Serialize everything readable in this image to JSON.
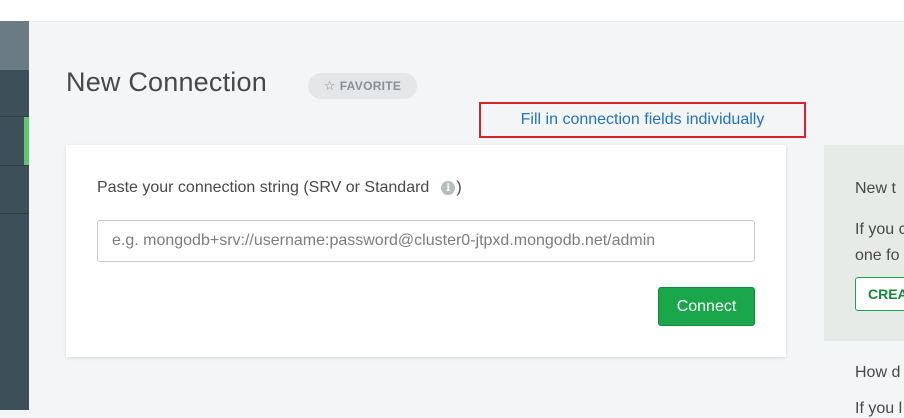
{
  "page": {
    "title": "New Connection",
    "favorite_label": "FAVORITE",
    "fill_fields_link": "Fill in connection fields individually"
  },
  "connection_card": {
    "label": "Paste your connection string (SRV or Standard",
    "label_suffix": ")",
    "info_icon_glyph": "i",
    "input_placeholder": "e.g. mongodb+srv://username:password@cluster0-jtpxd.mongodb.net/admin",
    "input_value": "",
    "connect_label": "Connect"
  },
  "side_panel": {
    "heading": "New t",
    "text_line1": "If you c",
    "text_line2": "one fo",
    "create_label": "CREA"
  },
  "side_lower": {
    "heading": "How d",
    "text_line1": "If you l"
  },
  "colors": {
    "sidebar": "#3d4f58",
    "active_indicator": "#5fc86e",
    "connect_button": "#1aa64a",
    "link": "#1f72c4",
    "highlight_border": "#d6242b"
  },
  "icons": {
    "favorite": "star-outline-icon",
    "info": "info-circle-icon"
  }
}
